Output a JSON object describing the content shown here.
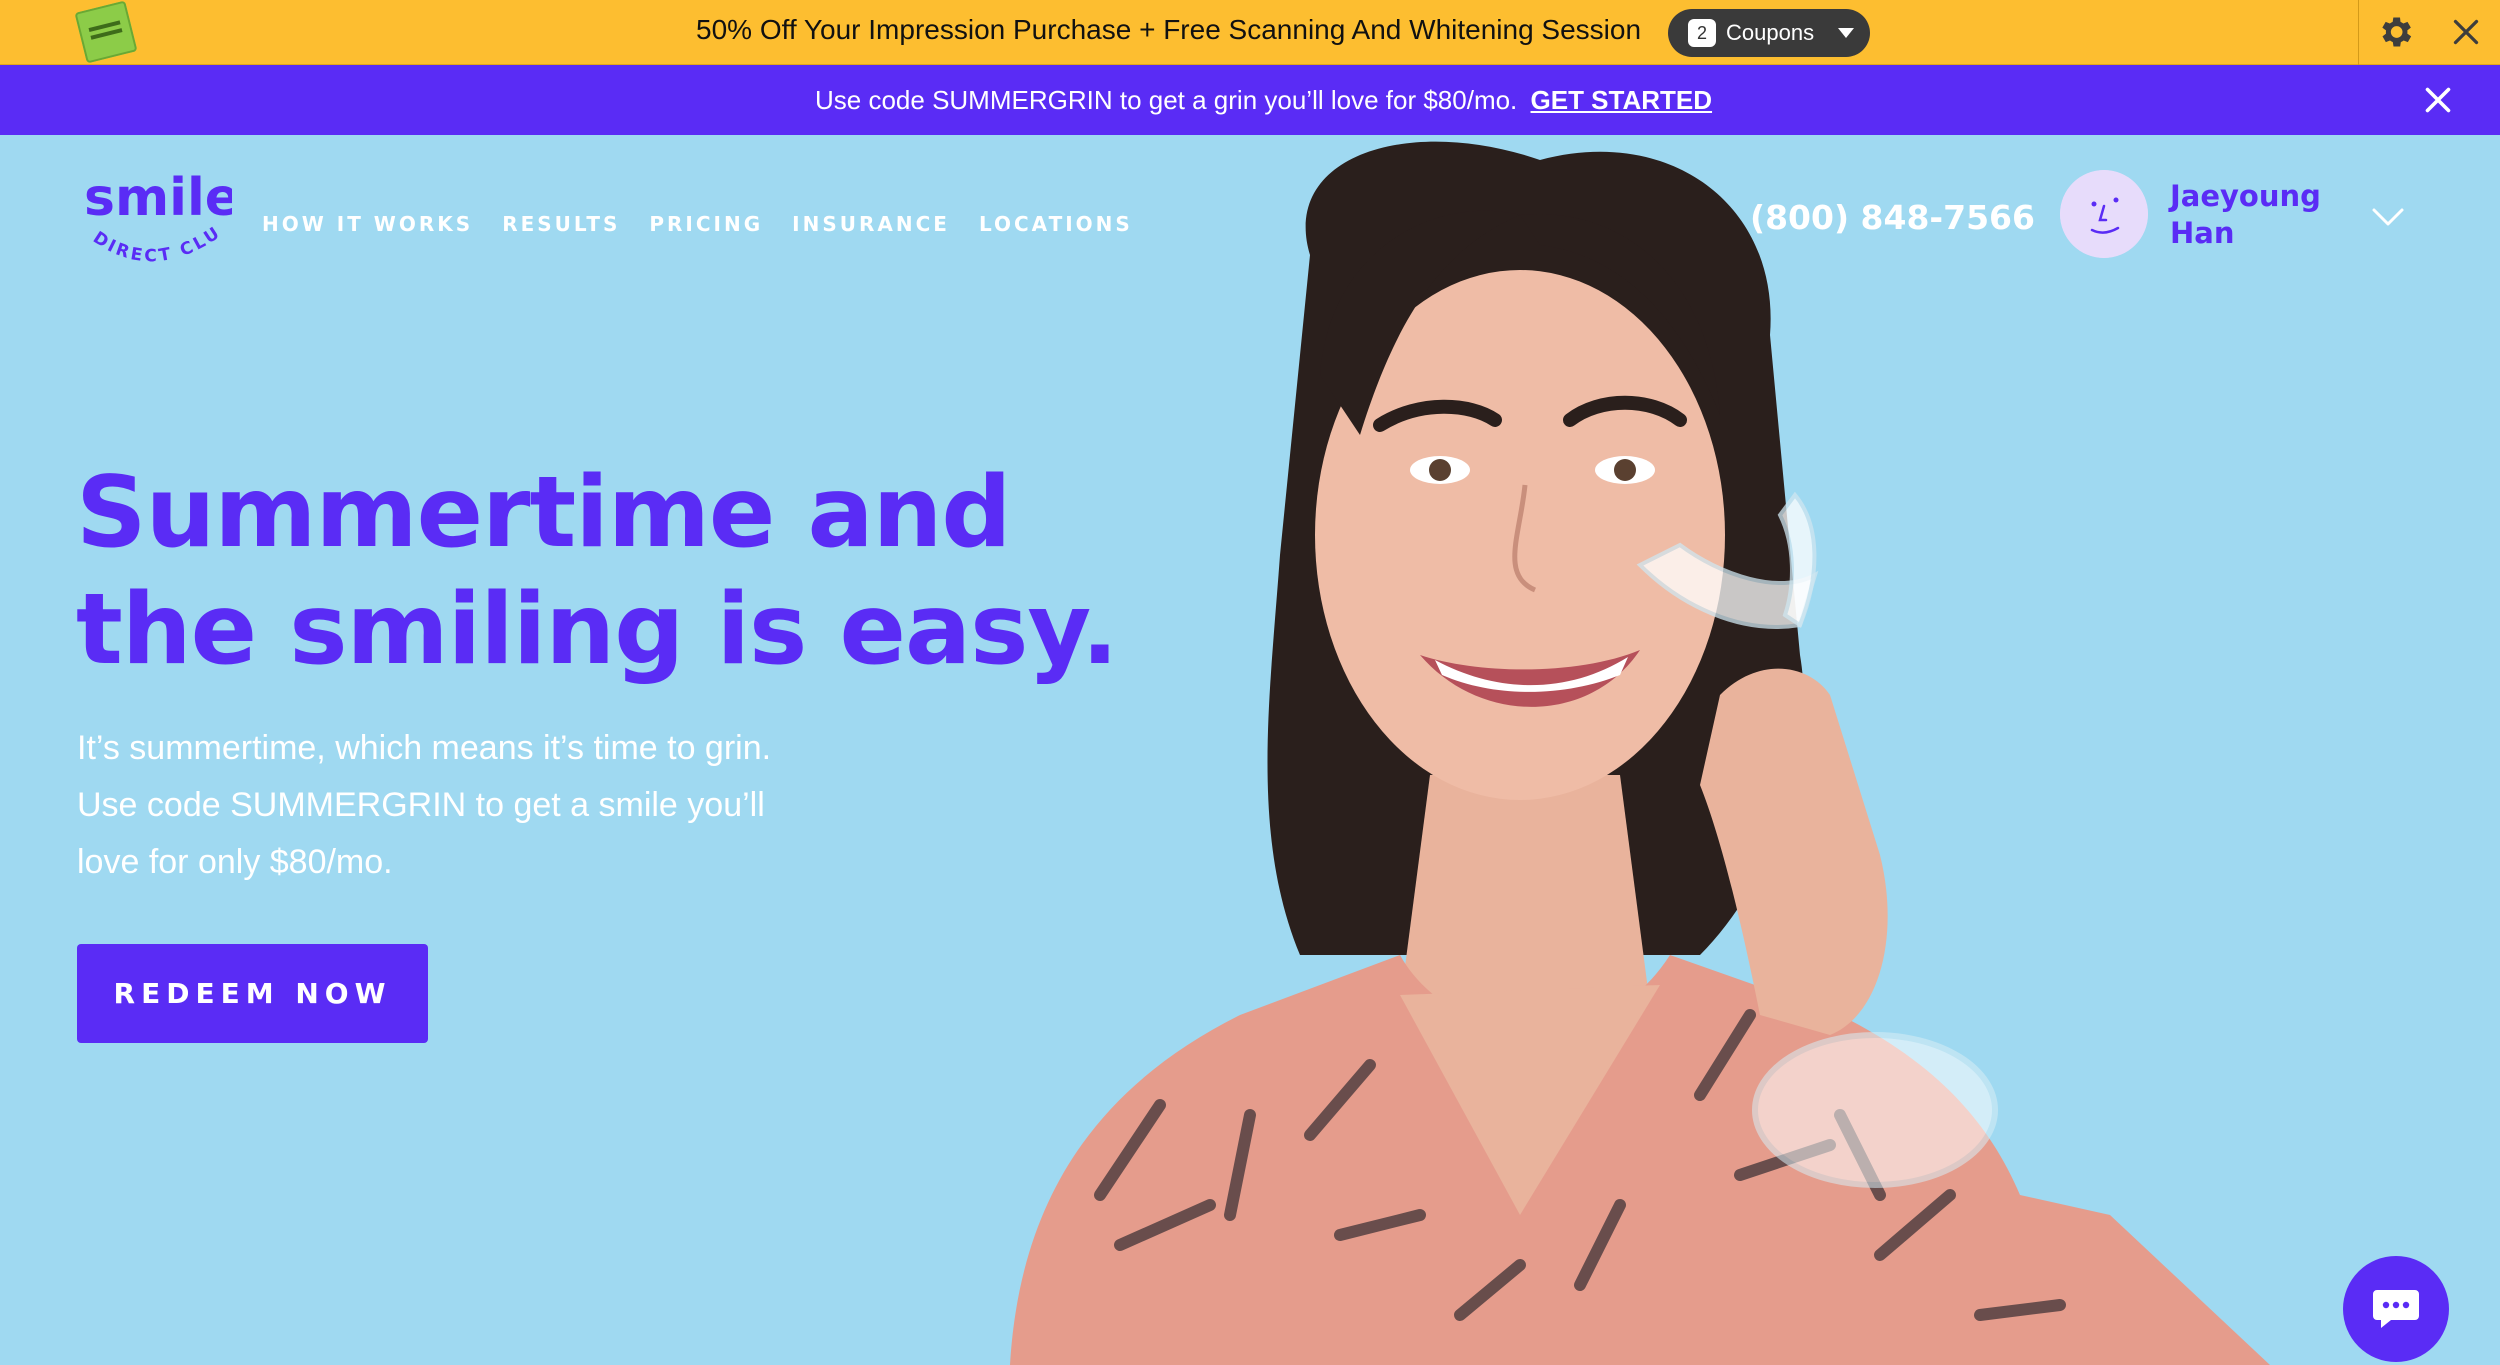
{
  "extension": {
    "offer_text": "50% Off Your Impression Purchase + Free Scanning And Whitening Session",
    "coupon_count": "2",
    "coupon_label": "Coupons",
    "icons": {
      "logo": "honey-logo-icon",
      "settings": "gear-icon",
      "close": "close-icon"
    }
  },
  "promo": {
    "text": "Use code SUMMERGRIN to get a grin you’ll love for $80/mo.",
    "link_label": "GET STARTED",
    "close_icon": "close-icon"
  },
  "header": {
    "brand_word": "smile",
    "brand_sub": "DIRECT CLUB",
    "nav": [
      {
        "label": "HOW IT WORKS"
      },
      {
        "label": "RESULTS"
      },
      {
        "label": "PRICING"
      },
      {
        "label": "INSURANCE"
      },
      {
        "label": "LOCATIONS"
      }
    ],
    "phone": "(800) 848-7566",
    "user": {
      "first": "Jaeyoung",
      "last": "Han",
      "avatar_icon": "avatar-face-icon",
      "chevron_icon": "chevron-down-icon"
    }
  },
  "hero": {
    "headline_line1": "Summertime and",
    "headline_line2": "the smiling is easy.",
    "subcopy_line1": "It’s summertime, which means it’s time to grin.",
    "subcopy_line2": "Use code SUMMERGRIN to get a smile you’ll",
    "subcopy_line3": "love for only $80/mo.",
    "cta_label": "REDEEM NOW",
    "photo": "woman-holding-clear-aligner-photo"
  },
  "chat": {
    "icon": "chat-bubble-icon"
  },
  "colors": {
    "brand_purple": "#5a2cf5",
    "hero_background": "#9fd9f1",
    "extension_bar": "#fdbe30"
  }
}
